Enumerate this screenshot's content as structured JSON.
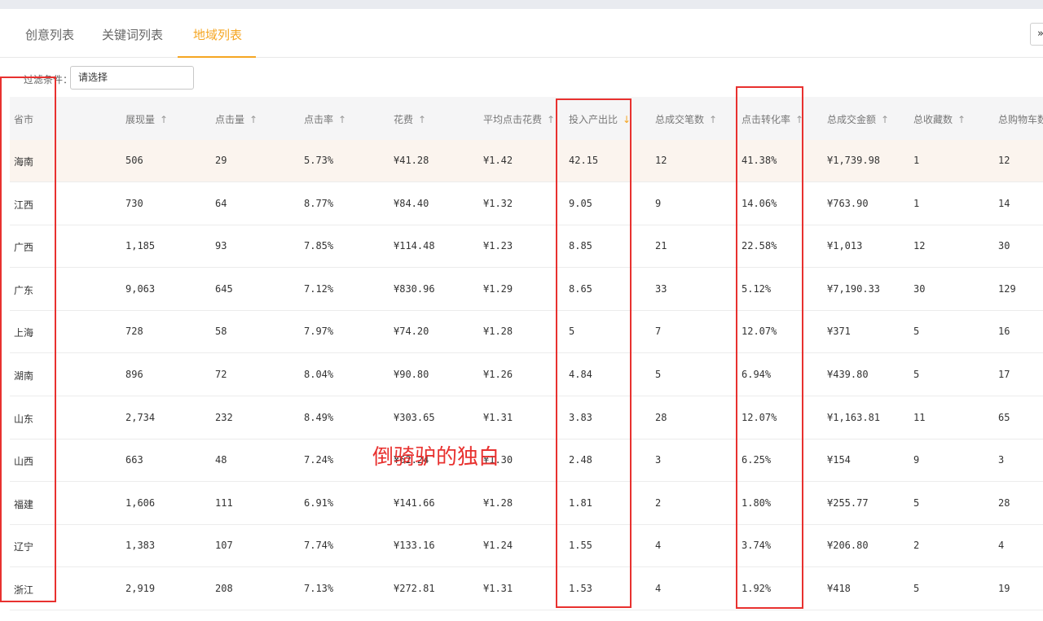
{
  "tabs": [
    {
      "label": "创意列表"
    },
    {
      "label": "关键词列表"
    },
    {
      "label": "地域列表",
      "active": true
    }
  ],
  "expand_button": {
    "label": "»"
  },
  "filter": {
    "label": "过滤条件：",
    "placeholder": "请选择"
  },
  "table": {
    "columns": [
      {
        "label": "省市",
        "arrow": ""
      },
      {
        "label": "展现量",
        "arrow": "↑"
      },
      {
        "label": "点击量",
        "arrow": "↑"
      },
      {
        "label": "点击率",
        "arrow": "↑"
      },
      {
        "label": "花费",
        "arrow": "↑"
      },
      {
        "label": "平均点击花费",
        "arrow": "↑"
      },
      {
        "label": "投入产出比",
        "arrow": "↓",
        "active": true
      },
      {
        "label": "总成交笔数",
        "arrow": "↑"
      },
      {
        "label": "点击转化率",
        "arrow": "↑"
      },
      {
        "label": "总成交金额",
        "arrow": "↑"
      },
      {
        "label": "总收藏数",
        "arrow": "↑"
      },
      {
        "label": "总购物车数",
        "arrow": ""
      }
    ],
    "rows": [
      [
        "海南",
        "506",
        "29",
        "5.73%",
        "¥41.28",
        "¥1.42",
        "42.15",
        "12",
        "41.38%",
        "¥1,739.98",
        "1",
        "12"
      ],
      [
        "江西",
        "730",
        "64",
        "8.77%",
        "¥84.40",
        "¥1.32",
        "9.05",
        "9",
        "14.06%",
        "¥763.90",
        "1",
        "14"
      ],
      [
        "广西",
        "1,185",
        "93",
        "7.85%",
        "¥114.48",
        "¥1.23",
        "8.85",
        "21",
        "22.58%",
        "¥1,013",
        "12",
        "30"
      ],
      [
        "广东",
        "9,063",
        "645",
        "7.12%",
        "¥830.96",
        "¥1.29",
        "8.65",
        "33",
        "5.12%",
        "¥7,190.33",
        "30",
        "129"
      ],
      [
        "上海",
        "728",
        "58",
        "7.97%",
        "¥74.20",
        "¥1.28",
        "5",
        "7",
        "12.07%",
        "¥371",
        "5",
        "16"
      ],
      [
        "湖南",
        "896",
        "72",
        "8.04%",
        "¥90.80",
        "¥1.26",
        "4.84",
        "5",
        "6.94%",
        "¥439.80",
        "5",
        "17"
      ],
      [
        "山东",
        "2,734",
        "232",
        "8.49%",
        "¥303.65",
        "¥1.31",
        "3.83",
        "28",
        "12.07%",
        "¥1,163.81",
        "11",
        "65"
      ],
      [
        "山西",
        "663",
        "48",
        "7.24%",
        "¥62.24",
        "¥1.30",
        "2.48",
        "3",
        "6.25%",
        "¥154",
        "9",
        "3"
      ],
      [
        "福建",
        "1,606",
        "111",
        "6.91%",
        "¥141.66",
        "¥1.28",
        "1.81",
        "2",
        "1.80%",
        "¥255.77",
        "5",
        "28"
      ],
      [
        "辽宁",
        "1,383",
        "107",
        "7.74%",
        "¥133.16",
        "¥1.24",
        "1.55",
        "4",
        "3.74%",
        "¥206.80",
        "2",
        "4"
      ],
      [
        "浙江",
        "2,919",
        "208",
        "7.13%",
        "¥272.81",
        "¥1.31",
        "1.53",
        "4",
        "1.92%",
        "¥418",
        "5",
        "19"
      ]
    ]
  },
  "watermark": {
    "text": "倒骑驴的独白"
  },
  "colors": {
    "accent": "#f5a623",
    "highlight_row": "#fbf4ee",
    "annotation_red": "#e8312f"
  }
}
